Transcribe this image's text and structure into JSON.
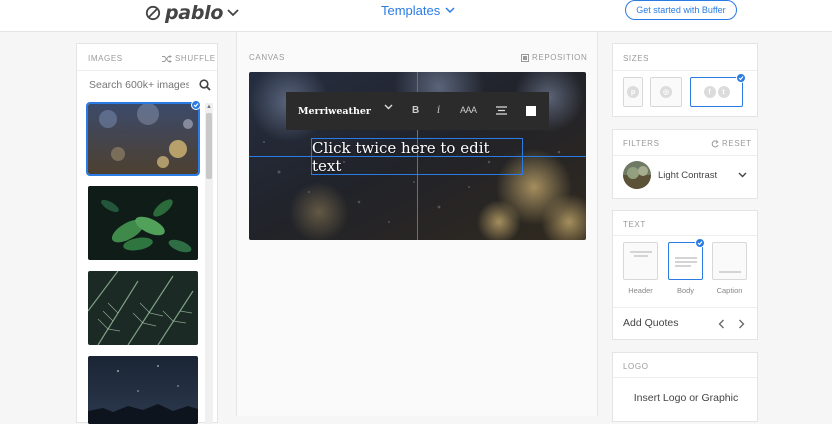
{
  "header": {
    "logo_text": "pablo",
    "templates_label": "Templates",
    "cta_label": "Get started with Buffer"
  },
  "images": {
    "section_label": "IMAGES",
    "shuffle_label": "SHUFFLE",
    "search_placeholder": "Search 600k+ images"
  },
  "canvas": {
    "section_label": "CANVAS",
    "reposition_label": "REPOSITION",
    "toolbar": {
      "font_name": "Merriweather",
      "bold_label": "B",
      "italic_label": "i",
      "size_label": "AAA"
    },
    "text": "Click twice here to edit text"
  },
  "sizes": {
    "section_label": "SIZES"
  },
  "filters": {
    "section_label": "FILTERS",
    "reset_label": "RESET",
    "selected_filter": "Light Contrast"
  },
  "text_panel": {
    "section_label": "TEXT",
    "styles": [
      "Header",
      "Body",
      "Caption"
    ],
    "add_quotes_label": "Add Quotes"
  },
  "logo": {
    "section_label": "LOGO",
    "insert_label": "Insert Logo or Graphic"
  },
  "colors": {
    "accent": "#2a7be4",
    "toolbar_bg": "#2b2b2b"
  }
}
